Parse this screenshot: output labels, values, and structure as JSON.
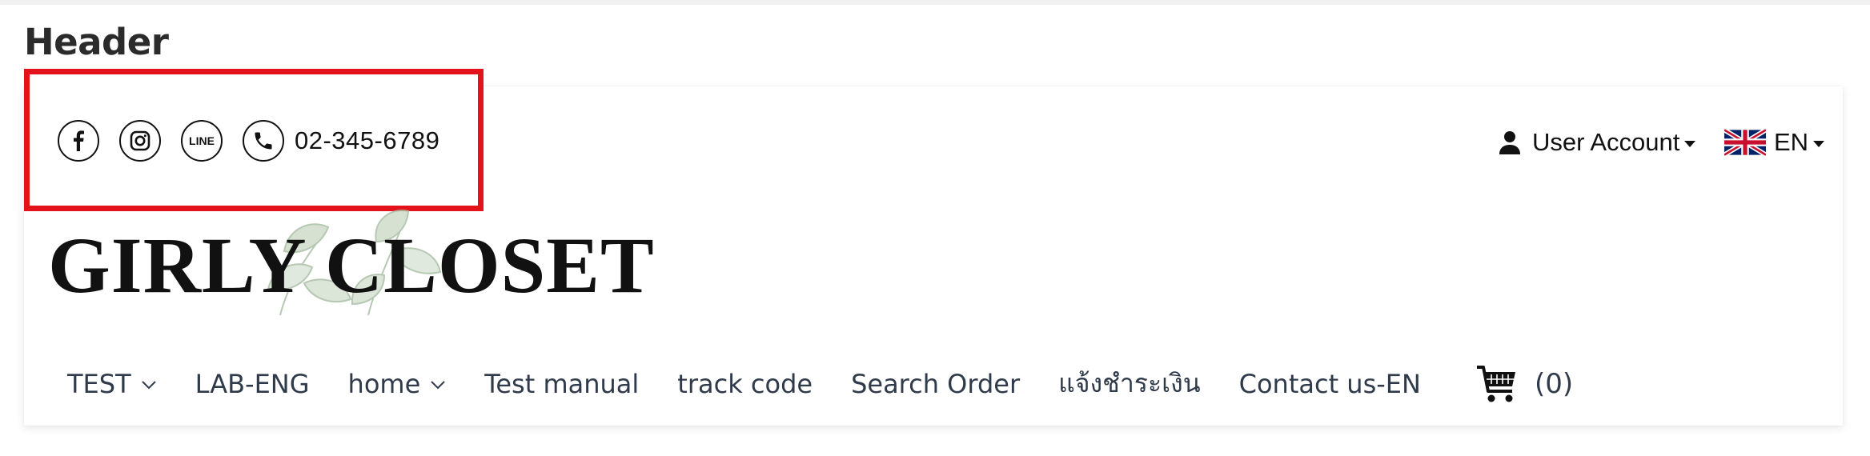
{
  "section": {
    "title": "Header"
  },
  "contacts": {
    "icons": [
      "facebook-icon",
      "instagram-icon",
      "line-icon",
      "phone-icon"
    ],
    "phone": "02-345-6789"
  },
  "account": {
    "label": "User Account",
    "icon": "user-icon"
  },
  "language": {
    "code": "EN",
    "flag": "uk-flag-icon"
  },
  "logo": {
    "text": "GIRLY CLOSET"
  },
  "nav": {
    "items": [
      {
        "label": "TEST",
        "has_dropdown": true
      },
      {
        "label": "LAB-ENG",
        "has_dropdown": false
      },
      {
        "label": "home",
        "has_dropdown": true
      },
      {
        "label": "Test manual",
        "has_dropdown": false
      },
      {
        "label": "track code",
        "has_dropdown": false
      },
      {
        "label": "Search Order",
        "has_dropdown": false
      },
      {
        "label": "แจ้งชำระเงิน",
        "has_dropdown": false
      },
      {
        "label": "Contact us-EN",
        "has_dropdown": false
      }
    ]
  },
  "cart": {
    "count": "(0)",
    "icon": "cart-icon"
  },
  "colors": {
    "highlight_border": "#e4131b",
    "nav_text": "#2f3a4a",
    "text": "#111111"
  }
}
